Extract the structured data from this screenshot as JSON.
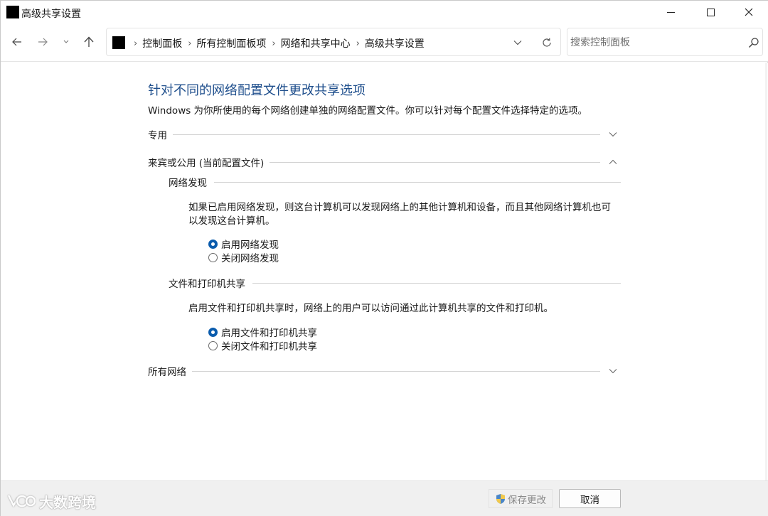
{
  "window": {
    "title": "高级共享设置"
  },
  "address_bar": {
    "breadcrumbs": [
      "控制面板",
      "所有控制面板项",
      "网络和共享中心",
      "高级共享设置"
    ]
  },
  "search": {
    "placeholder": "搜索控制面板"
  },
  "page": {
    "heading": "针对不同的网络配置文件更改共享选项",
    "description": "Windows 为你所使用的每个网络创建单独的网络配置文件。你可以针对每个配置文件选择特定的选项。"
  },
  "sections": {
    "private": {
      "label": "专用",
      "expanded": false
    },
    "guest_public": {
      "label": "来宾或公用 (当前配置文件)",
      "expanded": true
    },
    "all_networks": {
      "label": "所有网络",
      "expanded": false
    }
  },
  "network_discovery": {
    "title": "网络发现",
    "description": "如果已启用网络发现，则这台计算机可以发现网络上的其他计算机和设备，而且其他网络计算机也可以发现这台计算机。",
    "options": [
      {
        "label": "启用网络发现",
        "selected": true
      },
      {
        "label": "关闭网络发现",
        "selected": false
      }
    ]
  },
  "file_printer_sharing": {
    "title": "文件和打印机共享",
    "description": "启用文件和打印机共享时，网络上的用户可以访问通过此计算机共享的文件和打印机。",
    "options": [
      {
        "label": "启用文件和打印机共享",
        "selected": true
      },
      {
        "label": "关闭文件和打印机共享",
        "selected": false
      }
    ]
  },
  "footer": {
    "save_label": "保存更改",
    "cancel_label": "取消"
  },
  "watermark": {
    "text": "大数跨境"
  },
  "colors": {
    "heading": "#1e4e8c",
    "radio_selected": "#0b5cad",
    "footer_bg": "#f0f0f0"
  },
  "icons": [
    "back-arrow-icon",
    "forward-arrow-icon",
    "chevron-down-icon",
    "up-arrow-icon",
    "refresh-icon",
    "search-icon",
    "shield-icon",
    "minimize-icon",
    "maximize-icon",
    "close-icon"
  ]
}
